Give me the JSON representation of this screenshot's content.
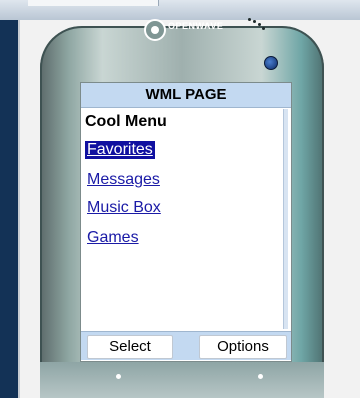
{
  "screen": {
    "title": "WML PAGE",
    "heading": "Cool Menu",
    "menu_items": [
      {
        "label": "Favorites"
      },
      {
        "label": "Messages"
      },
      {
        "label": "Music Box"
      },
      {
        "label": "Games"
      }
    ],
    "selected_index": 0
  },
  "softkeys": {
    "left": "Select",
    "right": "Options"
  },
  "brand": {
    "name": "OPENWAVE",
    "icon": "openwave-logo-icon"
  },
  "colors": {
    "title_bar": "#c3d9f1",
    "link": "#1a1aa6",
    "selection": "#1010a0"
  }
}
